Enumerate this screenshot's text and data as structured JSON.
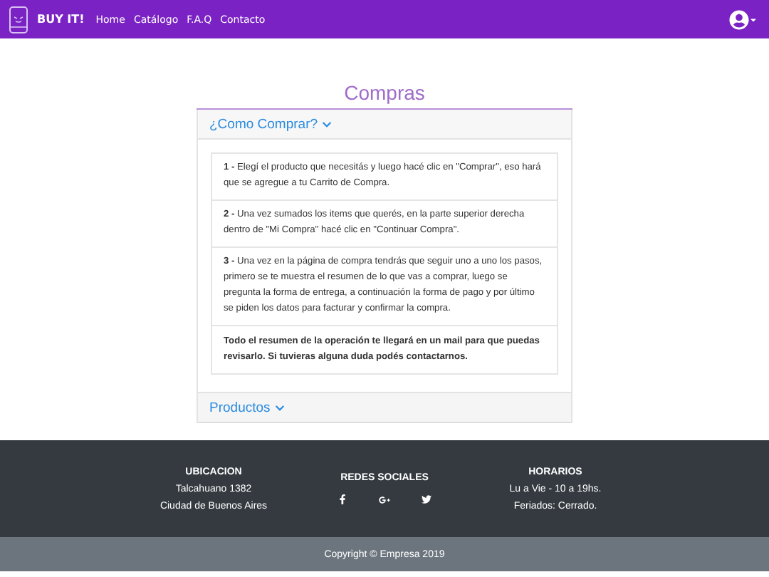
{
  "navbar": {
    "brand": "BUY IT!",
    "links": [
      {
        "label": "Home"
      },
      {
        "label": "Catálogo"
      },
      {
        "label": "F.A.Q"
      },
      {
        "label": "Contacto"
      }
    ]
  },
  "page_title": "Compras",
  "accordion": [
    {
      "title": "¿Como Comprar?",
      "expanded": true,
      "items": [
        {
          "kind": "step",
          "text": "**1 -** Elegí el producto que necesitás y luego hacé clic en \"Comprar\", eso hará que se agregue a tu Carrito de Compra."
        },
        {
          "kind": "step",
          "text": "**2 -** Una vez sumados los items que querés, en la parte superior derecha dentro de \"Mi Compra\" hacé clic en \"Continuar Compra\"."
        },
        {
          "kind": "step",
          "text": "**3 -** Una vez en la página de compra tendrás que seguir uno a uno los pasos, primero se te muestra el resumen de lo que vas a comprar, luego se pregunta la forma de entrega, a continuación la forma de pago y por último se piden los datos para facturar y confirmar la compra."
        },
        {
          "kind": "note",
          "text": "**Todo el resumen de la operación te llegará en un mail para que puedas revisarlo. Si tuvieras alguna duda podés contactarnos.**"
        }
      ]
    },
    {
      "title": "Productos",
      "expanded": false
    }
  ],
  "footer": {
    "columns": [
      {
        "kind": "text",
        "title": "UBICACION",
        "lines": [
          "Talcahuano 1382",
          "Ciudad de Buenos Aires"
        ]
      },
      {
        "kind": "social",
        "title": "REDES SOCIALES"
      },
      {
        "kind": "text",
        "title": "HORARIOS",
        "lines": [
          "Lu a Vie - 10 a 19hs.",
          "Feriados: Cerrado."
        ]
      }
    ],
    "copyright": "Copyright © Empresa 2019"
  }
}
